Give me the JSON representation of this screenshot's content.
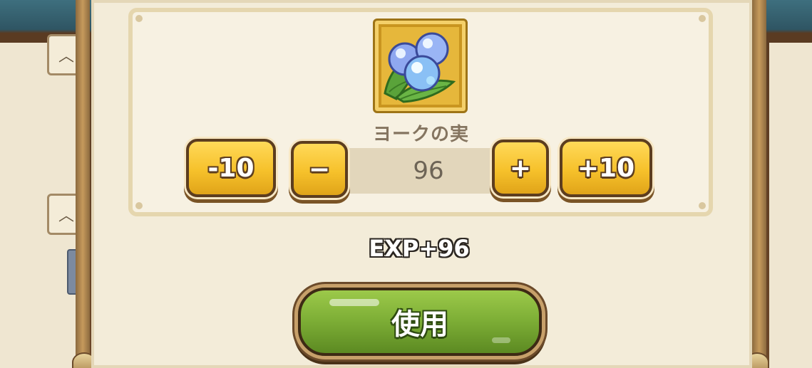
{
  "item": {
    "name": "ヨークの実",
    "icon": "blue-berries-on-leaf-icon"
  },
  "quantity": {
    "value": "96",
    "minus10_label": "-10",
    "minus_label": "−",
    "plus_label": "+",
    "plus10_label": "+10"
  },
  "exp_text": "EXP+96",
  "use_button_label": "使用",
  "colors": {
    "button_gold": "#f6c12b",
    "button_green": "#7fb037",
    "panel_bg": "#f3ecd9"
  }
}
